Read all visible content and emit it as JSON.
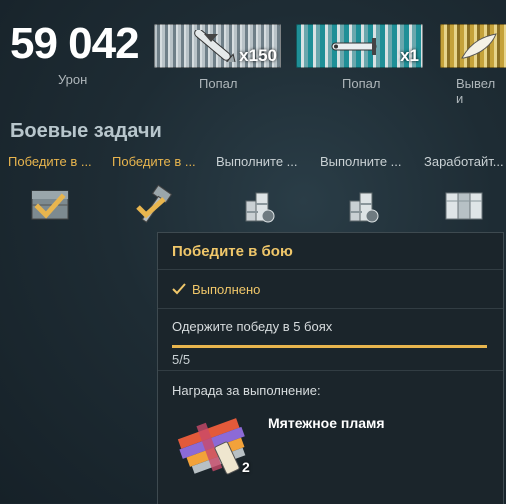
{
  "stats": {
    "damage_value": "59 042",
    "damage_label": "Урон"
  },
  "medals": [
    {
      "label": "Попал",
      "count": "x150",
      "icon": "torpedo-hit-icon"
    },
    {
      "label": "Попал",
      "count": "x1",
      "icon": "torpedo-icon"
    },
    {
      "label": "Вывел и",
      "count": "",
      "icon": "feather-icon"
    }
  ],
  "combat_tasks": {
    "title": "Боевые задачи",
    "items": [
      {
        "label": "Победите в ...",
        "icon": "crate-check-icon",
        "completed": true
      },
      {
        "label": "Победите в ...",
        "icon": "hammer-check-icon",
        "completed": true
      },
      {
        "label": "Выполните ...",
        "icon": "coins-icon",
        "completed": false
      },
      {
        "label": "Выполните ...",
        "icon": "coins-icon",
        "completed": false
      },
      {
        "label": "Заработайт...",
        "icon": "container-icon",
        "completed": false
      }
    ]
  },
  "popup": {
    "title": "Победите в бою",
    "status": "Выполнено",
    "description": "Одержите победу в 5 боях",
    "progress": {
      "current": 5,
      "total": 5,
      "text": "5/5"
    },
    "reward_label": "Награда за выполнение:",
    "reward_name": "Мятежное пламя",
    "reward_count": "2",
    "reward_icon": "camouflage-icon"
  },
  "colors": {
    "accent": "#e8b54e",
    "title": "#f0c76a"
  }
}
